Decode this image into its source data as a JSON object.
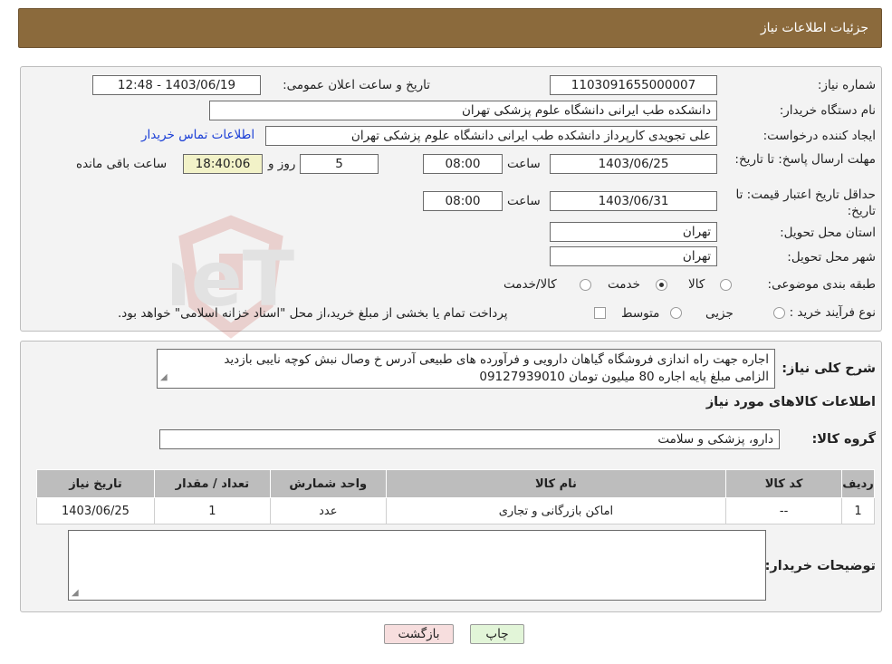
{
  "header": {
    "title": "جزئیات اطلاعات نیاز"
  },
  "form": {
    "need_number": {
      "label": "شماره نیاز:",
      "value": "1103091655000007"
    },
    "announce_datetime": {
      "label": "تاریخ و ساعت اعلان عمومی:",
      "value": "1403/06/19 - 12:48"
    },
    "buyer_org": {
      "label": "نام دستگاه خریدار:",
      "value": "دانشکده طب ایرانی دانشگاه علوم پزشکی تهران"
    },
    "requester": {
      "label": "ایجاد کننده درخواست:",
      "value": "علی تجویدی کارپرداز دانشکده طب ایرانی دانشگاه علوم پزشکی تهران",
      "contact_link": "اطلاعات تماس خریدار"
    },
    "reply_deadline": {
      "label": "مهلت ارسال پاسخ: تا تاریخ:",
      "date": "1403/06/25",
      "time_label": "ساعت",
      "time": "08:00",
      "days": "5",
      "days_label": "روز و",
      "remaining": "18:40:06",
      "remaining_label": "ساعت باقی مانده"
    },
    "price_validity": {
      "label": "حداقل تاریخ اعتبار قیمت: تا تاریخ:",
      "date": "1403/06/31",
      "time_label": "ساعت",
      "time": "08:00"
    },
    "delivery_province": {
      "label": "استان محل تحویل:",
      "value": "تهران"
    },
    "delivery_city": {
      "label": "شهر محل تحویل:",
      "value": "تهران"
    },
    "category": {
      "label": "طبقه بندی موضوعی:",
      "options": [
        "کالا",
        "خدمت",
        "کالا/خدمت"
      ],
      "selected": 1
    },
    "process_type": {
      "label": "نوع فرآیند خرید :",
      "options": [
        "جزیی",
        "متوسط"
      ],
      "note": "پرداخت تمام یا بخشی از مبلغ خرید،از محل \"اسناد خزانه اسلامی\" خواهد بود."
    }
  },
  "description": {
    "label": "شرح کلی نیاز:",
    "line1": "اجاره جهت راه اندازی فروشگاه گیاهان دارویی و فرآورده های طبیعی آدرس خ وصال نبش کوچه نایبی بازدید",
    "line2": "الزامی مبلغ پایه اجاره 80 میلیون تومان 09127939010"
  },
  "goods_info": {
    "title": "اطلاعات کالاهای مورد نیاز",
    "group_label": "گروه کالا:",
    "group_value": "دارو، پزشکی و سلامت"
  },
  "table": {
    "headers": [
      "ردیف",
      "کد کالا",
      "نام کالا",
      "واحد شمارش",
      "تعداد / مقدار",
      "تاریخ نیاز"
    ],
    "rows": [
      [
        "1",
        "--",
        "اماکن بازرگانی و تجاری",
        "عدد",
        "1",
        "1403/06/25"
      ]
    ]
  },
  "buyer_notes": {
    "label": "توضیحات خریدار:",
    "value": ""
  },
  "buttons": {
    "print": "چاپ",
    "back": "بازگشت"
  },
  "watermark": "AriaTender.neT",
  "colors": {
    "header": "#8b6a3c",
    "link": "#1a3ed6",
    "back_button": "#f7dede",
    "print_button": "#e2f5d8"
  }
}
